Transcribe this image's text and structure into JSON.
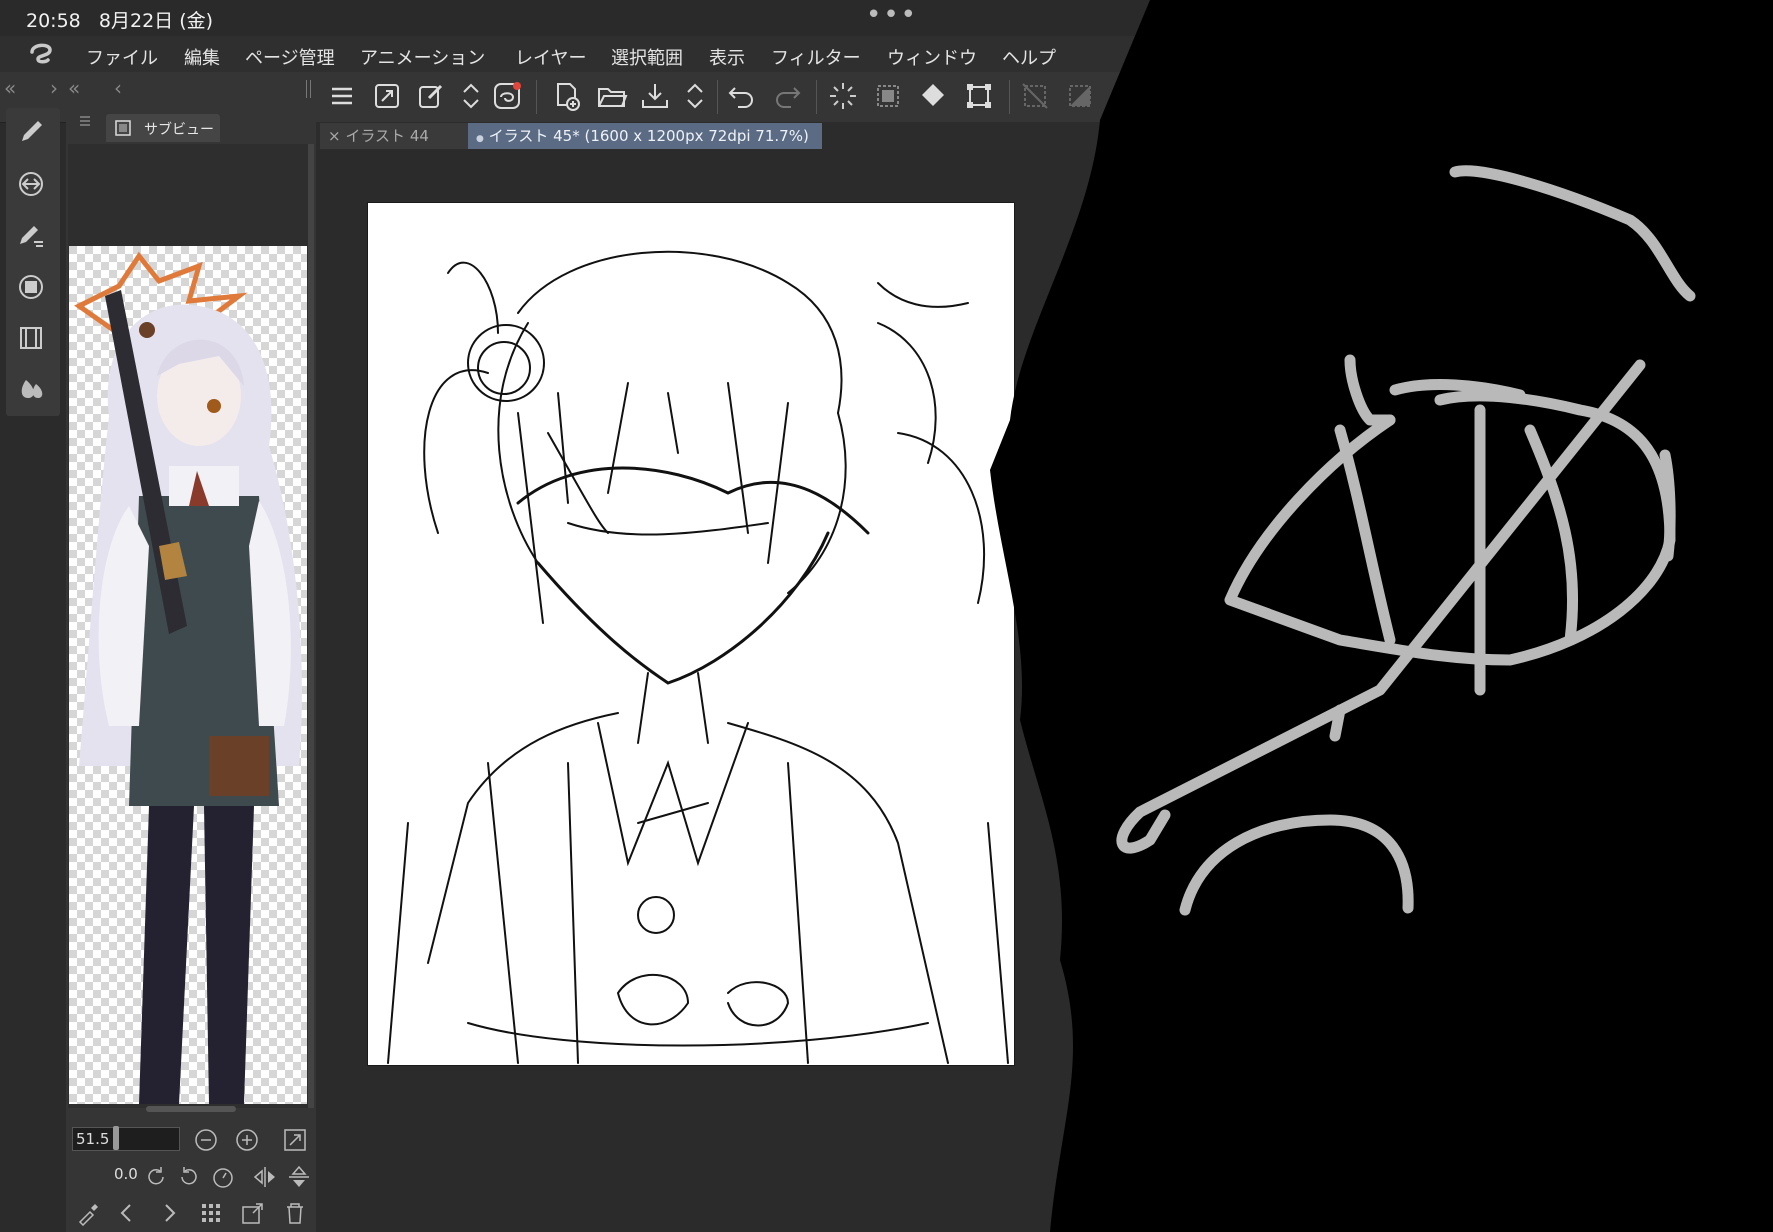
{
  "status": {
    "time": "20:58",
    "date": "8月22日 (金)",
    "more": "•••"
  },
  "menu": [
    "ファイル",
    "編集",
    "ページ管理",
    "アニメーション",
    "レイヤー",
    "選択範囲",
    "表示",
    "フィルター",
    "ウィンドウ",
    "ヘルプ"
  ],
  "panel_nav": {
    "collapse_left": "«",
    "next": "›",
    "collapse_left2": "«",
    "prev": "‹"
  },
  "subview": {
    "tab_label": "サブビュー",
    "zoom": "51.5",
    "rotation": "0.0"
  },
  "tabs": [
    {
      "label": "イラスト 44",
      "close": "×",
      "active": false
    },
    {
      "label": "イラスト 45* (1600 x 1200px 72dpi 71.7%)",
      "dot": "●",
      "active": true
    }
  ],
  "toolbar_icons": [
    "menu-icon",
    "resize-icon",
    "edit-icon",
    "arrows-updown-icon",
    "companion-icon",
    "new-canvas-icon",
    "open-folder-icon",
    "save-icon",
    "arrows-updown-icon",
    "undo-icon",
    "redo-icon",
    "loading-icon",
    "select-icon",
    "fill-icon",
    "transform-icon",
    "deselect-icon",
    "invert-icon"
  ],
  "colors": {
    "accent_tab": "#5b6b84",
    "background": "#2b2b2b",
    "panel": "#353535",
    "overlay": "#000000",
    "overlay_stroke": "#b9b9b9"
  }
}
